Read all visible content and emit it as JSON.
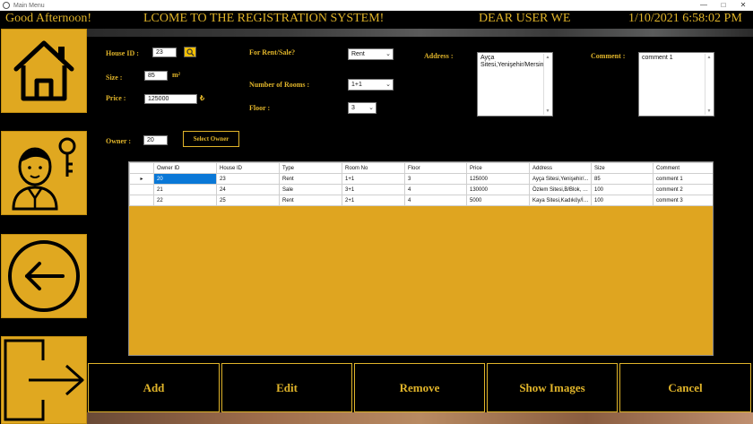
{
  "window": {
    "title": "Main Menu"
  },
  "header": {
    "greeting": "Good Afternoon!",
    "welcome": "LCOME TO THE REGISTRATION SYSTEM!",
    "user": "DEAR USER WE",
    "datetime": "1/10/2021 6:58:02 PM"
  },
  "form": {
    "house_id_label": "House ID :",
    "house_id_value": "23",
    "size_label": "Size :",
    "size_value": "85",
    "size_unit": "m²",
    "price_label": "Price :",
    "price_value": "125000",
    "price_unit": "₺",
    "owner_label": "Owner :",
    "owner_value": "20",
    "select_owner_label": "Select Owner",
    "rent_sale_label": "For Rent/Sale?",
    "rent_sale_value": "Rent",
    "rooms_label": "Number of Rooms :",
    "rooms_value": "1+1",
    "floor_label": "Floor :",
    "floor_value": "3",
    "address_label": "Address :",
    "address_value": "Ayça Sitesi,Yenişehir/Mersin",
    "comment_label": "Comment :",
    "comment_value": "comment 1"
  },
  "grid": {
    "columns": [
      "Owner ID",
      "House ID",
      "Type",
      "Room No",
      "Floor",
      "Price",
      "Address",
      "Size",
      "Comment"
    ],
    "rows": [
      [
        "20",
        "23",
        "Rent",
        "1+1",
        "3",
        "125000",
        "Ayça Sitesi,Yenişehir/...",
        "85",
        "comment 1"
      ],
      [
        "21",
        "24",
        "Sale",
        "3+1",
        "4",
        "130000",
        "Özlem Sitesi,B/Blok, Er...",
        "100",
        "comment 2"
      ],
      [
        "22",
        "25",
        "Rent",
        "2+1",
        "4",
        "5000",
        "Kaya Sitesi,Kadıköy/İst...",
        "100",
        "comment 3"
      ]
    ]
  },
  "actions": {
    "add": "Add",
    "edit": "Edit",
    "remove": "Remove",
    "show_images": "Show Images",
    "cancel": "Cancel"
  },
  "sidebar": {
    "items": [
      "home-icon",
      "user-key-icon",
      "back-arrow-icon",
      "logout-icon"
    ]
  },
  "colors": {
    "accent": "#e0a820",
    "background": "#000000",
    "selection": "#0a78d7"
  }
}
